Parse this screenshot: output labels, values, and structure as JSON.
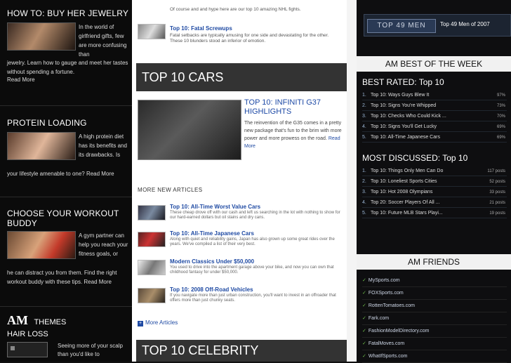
{
  "left": {
    "s1_title": "HOW TO: BUY HER JEWELRY",
    "s1_text": "In the world of girlfriend gifts, few are more confusing than",
    "s1_full": "jewelry. Learn how to gauge and meet her tastes without spending a fortune.",
    "s1_more": "Read More",
    "s2_title": "PROTEIN LOADING",
    "s2_text": "A high protein diet has its benefits and its drawbacks. Is",
    "s2_full": "your lifestyle amenable to one? Read More",
    "s3_title": "CHOOSE YOUR WORKOUT BUDDY",
    "s3_text": "A gym partner can help you reach your fitness goals, or",
    "s3_full": "he can distract you from them. Find the right workout buddy with these tips. Read More",
    "themes_brand": "AM",
    "themes_label": "THEMES",
    "hair_title": "HAIR LOSS",
    "hair_text": "Seeing more of your scalp than you'd like to"
  },
  "mid": {
    "top_snip_body": "Of course and and hype here are our top 10 amazing NHL fights.",
    "top_snip_link": "Top 10: Fatal Screwups",
    "top_snip_desc": "Fatal setbacks are typically amusing for one side and devastating for the other. These 10 blunders stood an inferior of emotion.",
    "band1": "TOP 10 CARS",
    "feature_title": "TOP 10: INFINITI G37 HIGHLIGHTS",
    "feature_text": "The reinvention of the G35 comes in a pretty new package that's fun to the brim with more power and more prowess on the road.",
    "feature_more": "Read More",
    "more_head": "MORE NEW ARTICLES",
    "items": [
      {
        "title": "Top 10: All-Time Worst Value Cars",
        "desc": "These cheap drove off with our cash and left us searching in the lot with nothing to show for our hard-earned dollars but oil stains and dry cans."
      },
      {
        "title": "Top 10: All-Time Japanese Cars",
        "desc": "Along with quiet and reliability gains, Japan has also grown up some great rides over the years. We've compiled a list of their very best."
      },
      {
        "title": "Modern Classics Under $50,000",
        "desc": "You used to drive into the apartment garage above your bike, and now you can own that childhood fantasy for under $50,000."
      },
      {
        "title": "Top 10: 2008 Off-Road Vehicles",
        "desc": "If you navigate more than just urban construction, you'll want to invest in an offroader that offers more than just chunky seats."
      }
    ],
    "more_articles": "More Articles",
    "band2": "TOP 10 CELEBRITY"
  },
  "right": {
    "banner_logo": "TOP 49 MEN",
    "banner_text": "Top 49 Men of 2007",
    "best_header": "AM BEST OF THE WEEK",
    "best_rated_title": "BEST RATED: Top 10",
    "best_rated": [
      {
        "rank": "1.",
        "title": "Top 10: Ways Guys Blew It",
        "value": "97%"
      },
      {
        "rank": "2.",
        "title": "Top 10: Signs You're Whipped",
        "value": "73%"
      },
      {
        "rank": "3.",
        "title": "Top 10: Checks Who Could Kick ...",
        "value": "70%"
      },
      {
        "rank": "4.",
        "title": "Top 10: Signs You'll Get Lucky",
        "value": "69%"
      },
      {
        "rank": "5.",
        "title": "Top 10: All-Time Japanese Cars",
        "value": "69%"
      }
    ],
    "most_discussed_title": "MOST DISCUSSED: Top 10",
    "most_discussed": [
      {
        "rank": "1.",
        "title": "Top 10: Things Only Men Can Do",
        "value": "117 posts"
      },
      {
        "rank": "2.",
        "title": "Top 10: Loneliest Sports Cities",
        "value": "52 posts"
      },
      {
        "rank": "3.",
        "title": "Top 10: Hot 2008 Olympians",
        "value": "33 posts"
      },
      {
        "rank": "4.",
        "title": "Top 20: Soccer Players Of All ...",
        "value": "21 posts"
      },
      {
        "rank": "5.",
        "title": "Top 10: Future MLB Stars Playi...",
        "value": "19 posts"
      }
    ],
    "friends_header": "AM FRIENDS",
    "friends": [
      "MySports.com",
      "FOXSports.com",
      "RottenTomatoes.com",
      "Fark.com",
      "FashionModelDirectory.com",
      "FatalMoves.com",
      "WhatIfSports.com"
    ]
  }
}
